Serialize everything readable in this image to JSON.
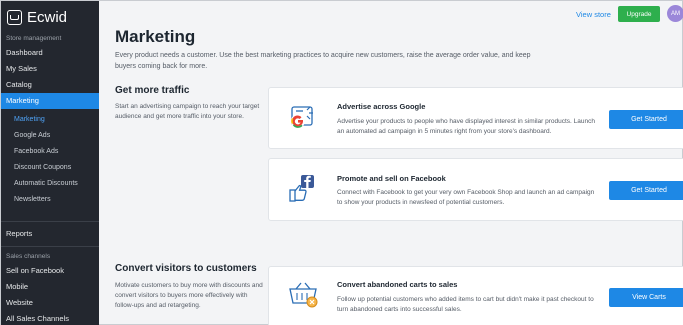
{
  "app": {
    "name": "Ecwid"
  },
  "sidebar": {
    "store_management_label": "Store management",
    "items": [
      {
        "label": "Dashboard"
      },
      {
        "label": "My Sales"
      },
      {
        "label": "Catalog"
      },
      {
        "label": "Marketing"
      }
    ],
    "subitems": [
      {
        "label": "Marketing"
      },
      {
        "label": "Google Ads"
      },
      {
        "label": "Facebook Ads"
      },
      {
        "label": "Discount Coupons"
      },
      {
        "label": "Automatic Discounts"
      },
      {
        "label": "Newsletters"
      }
    ],
    "reports_label": "Reports",
    "sales_channels_label": "Sales channels",
    "channels": [
      {
        "label": "Sell on Facebook"
      },
      {
        "label": "Mobile"
      },
      {
        "label": "Website"
      },
      {
        "label": "All Sales Channels"
      }
    ]
  },
  "topbar": {
    "view_store": "View store",
    "upgrade": "Upgrade",
    "avatar_initials": "AM"
  },
  "page": {
    "title": "Marketing",
    "description": "Every product needs a customer. Use the best marketing practices to acquire new customers, raise the average order value, and keep buyers coming back for more."
  },
  "sections": {
    "traffic": {
      "title": "Get more traffic",
      "description": "Start an advertising campaign to reach your target audience and get more traffic into your store."
    },
    "convert": {
      "title": "Convert visitors to customers",
      "description": "Motivate customers to buy more with discounts and convert visitors to buyers more effectively with follow-ups and ad retargeting."
    }
  },
  "cards": {
    "google": {
      "title": "Advertise across Google",
      "description": "Advertise your products to people who have displayed interest in similar products. Launch an automated ad campaign in 5 minutes right from your store's dashboard.",
      "button": "Get Started",
      "icon": "google-ads-icon"
    },
    "facebook": {
      "title": "Promote and sell on Facebook",
      "description": "Connect with Facebook to get your very own Facebook Shop and launch an ad campaign to show your products in newsfeed of potential customers.",
      "button": "Get Started",
      "icon": "facebook-like-icon"
    },
    "carts": {
      "title": "Convert abandoned carts to sales",
      "description": "Follow up potential customers who added items to cart but didn't make it past checkout to turn abandoned carts into successful sales.",
      "button": "View Carts",
      "icon": "abandoned-cart-icon"
    }
  },
  "colors": {
    "accent": "#1e88e5",
    "upgrade": "#2eaf4d",
    "sidebar": "#23272f"
  }
}
